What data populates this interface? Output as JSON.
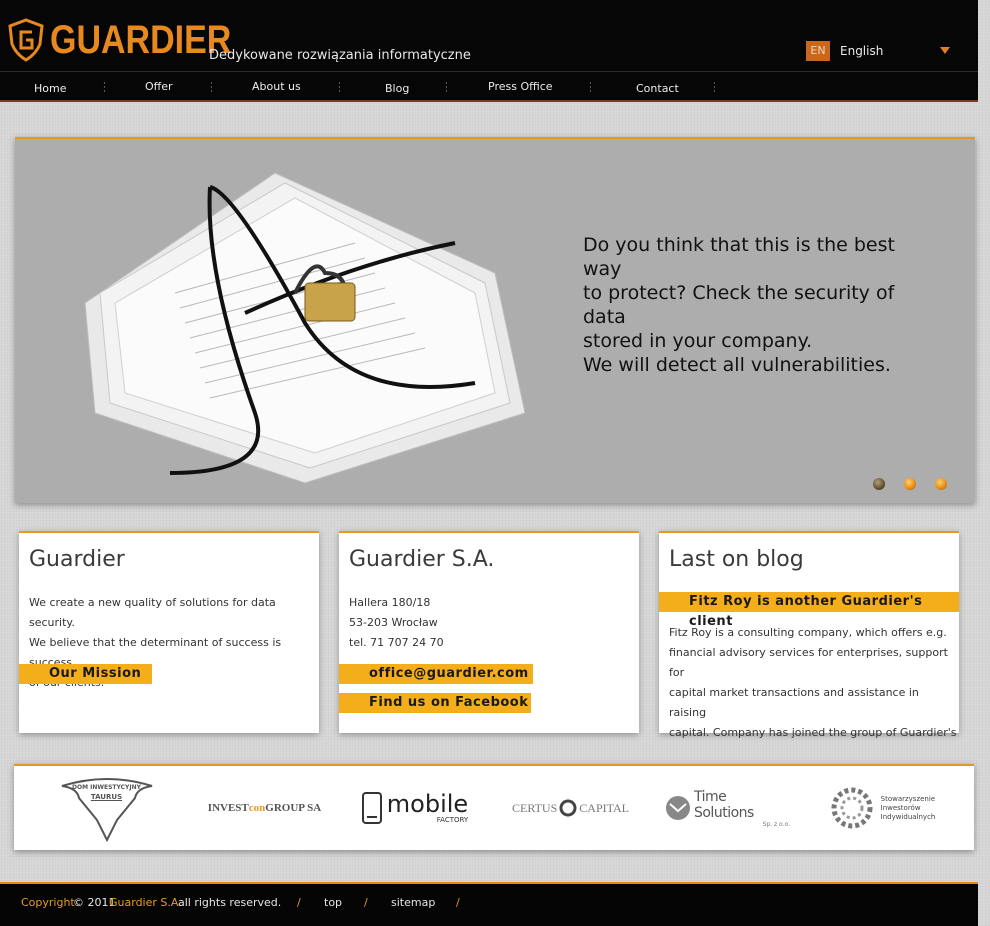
{
  "header": {
    "brand": "GUARDIER",
    "tagline": "Dedykowane rozwiązania informatyczne",
    "lang_code": "EN",
    "lang_name": "English"
  },
  "nav": [
    {
      "label": "Home"
    },
    {
      "label": "Offer"
    },
    {
      "label": "About us"
    },
    {
      "label": "Blog"
    },
    {
      "label": "Press Office"
    },
    {
      "label": "Contact"
    }
  ],
  "slider": {
    "text_lines": [
      "Do you think that this is the best way",
      "to protect? Check the security of data",
      "stored in your company.",
      "We will detect all vulnerabilities."
    ],
    "active_slide": 1,
    "slide_count": 3
  },
  "boxes": {
    "guardier": {
      "title": "Guardier",
      "lines": [
        "We create a new quality of solutions for data security.",
        "We believe that the determinant of success is success",
        "of our clients."
      ],
      "button": "Our Mission"
    },
    "company": {
      "title": "Guardier S.A.",
      "address": [
        "Hallera 180/18",
        "53-203 Wrocław",
        "tel. 71 707 24 70"
      ],
      "email_button": "office@guardier.com",
      "facebook_button": "Find us on Facebook"
    },
    "blog": {
      "title": "Last on blog",
      "post_title": "Fitz Roy is another Guardier's client",
      "excerpt_lines": [
        "Fitz Roy is a consulting company, which offers e.g.",
        "financial advisory services for enterprises, support for",
        "capital market transactions and assistance in raising",
        "capital. Company has joined the group of Guardier's"
      ]
    }
  },
  "partners": {
    "taurus": {
      "line1": "DOM INWESTYCYJNY",
      "line2": "TAURUS"
    },
    "invest": {
      "pre": "INVEST",
      "mid": "con",
      "post": " GROUP SA"
    },
    "mobile": {
      "main": "mobile",
      "sub": "FACTORY"
    },
    "certus": {
      "left": "CERTUS",
      "right": "CAPITAL"
    },
    "time": {
      "main": "Time Solutions",
      "sub": "Sp. z o.o."
    },
    "siw": {
      "lines": [
        "Stowarzyszenie",
        "Inwestorów",
        "Indywidualnych"
      ]
    }
  },
  "footer": {
    "copyright": "Copyright",
    "year": "© 2011",
    "company": "Guardier S.A.",
    "rights": "all rights reserved.",
    "sep": "/",
    "top": "top",
    "sitemap": "sitemap"
  },
  "colors": {
    "accent": "#e79622",
    "button": "#f4ae1a",
    "header_bg": "#060606"
  }
}
